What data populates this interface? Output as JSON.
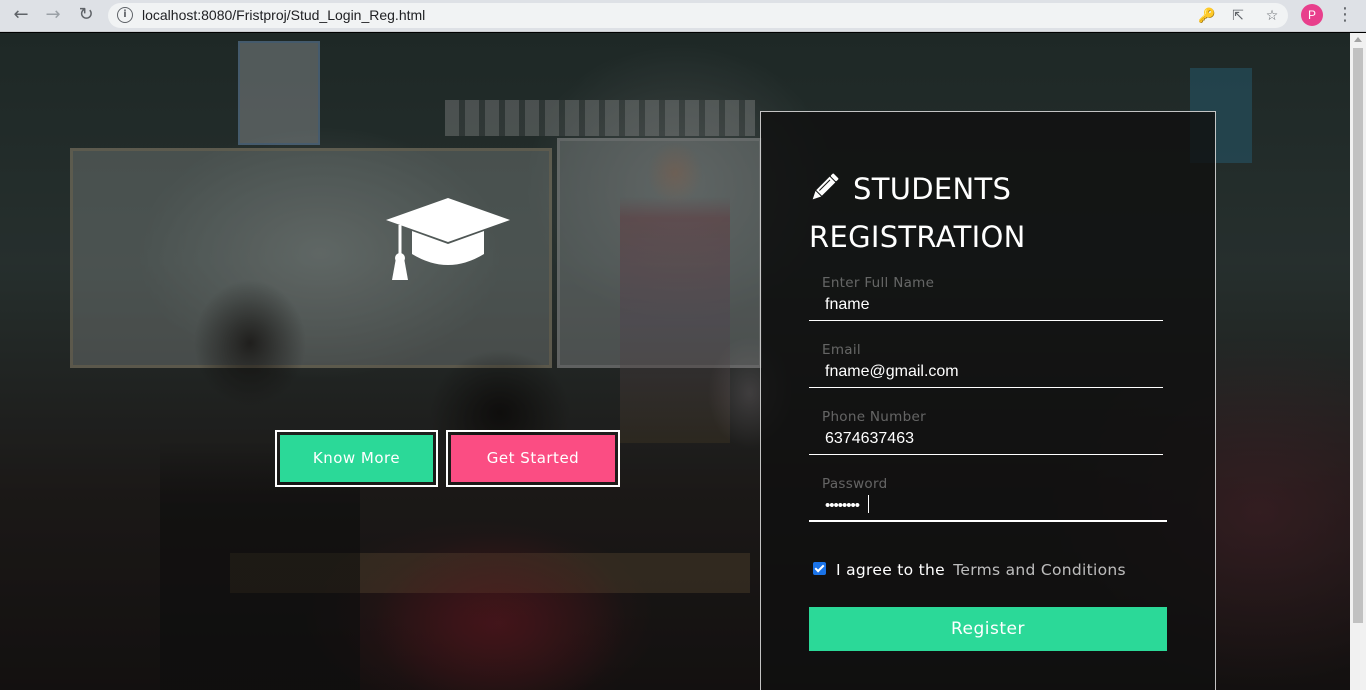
{
  "browser": {
    "url": "localhost:8080/Fristproj/Stud_Login_Reg.html",
    "profile_initial": "P",
    "icons": [
      "back-icon",
      "forward-icon",
      "reload-icon",
      "info-icon",
      "key-icon",
      "share-icon",
      "star-icon",
      "menu-icon"
    ]
  },
  "hero": {
    "icon": "graduation-cap-icon",
    "know_more_label": "Know More",
    "get_started_label": "Get Started"
  },
  "registration": {
    "title_line1": "STUDENTS",
    "title_line2": "REGISTRATION",
    "title_icon": "pencil-icon",
    "fields": [
      {
        "label": "Enter Full Name",
        "value": "fname"
      },
      {
        "label": "Email",
        "value": "fname@gmail.com"
      },
      {
        "label": "Phone Number",
        "value": "6374637463"
      },
      {
        "label": "Password",
        "value": "••••••••"
      }
    ],
    "agree_text": "I agree to the",
    "terms_link": "Terms and Conditions",
    "agree_checked": true,
    "register_label": "Register"
  },
  "colors": {
    "accent_green": "#2bd998",
    "accent_pink": "#fb4d83",
    "checkbox_blue": "#1a73e8"
  }
}
